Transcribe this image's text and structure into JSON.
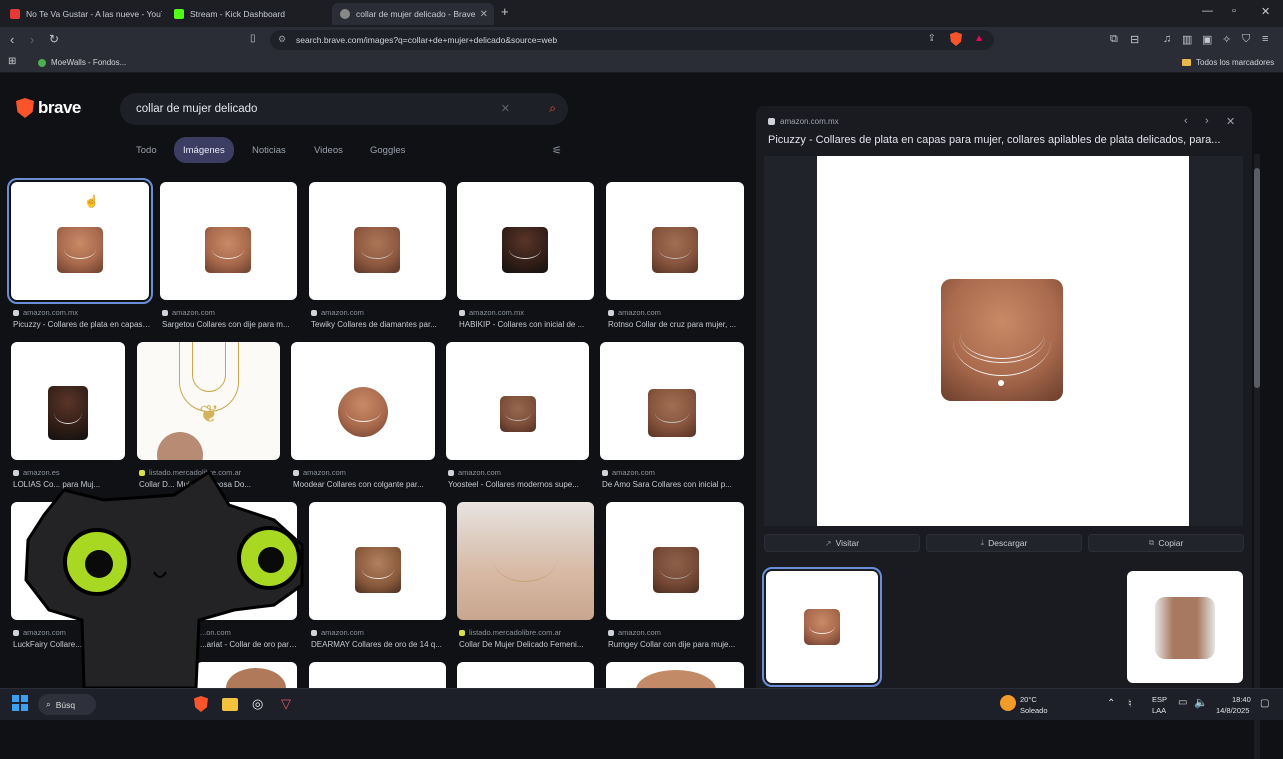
{
  "browser": {
    "tabs": [
      {
        "title": "No Te Va Gustar - A las nueve - YouTube",
        "active": false
      },
      {
        "title": "Stream - Kick Dashboard",
        "active": false
      },
      {
        "title": "collar de mujer delicado - Brave",
        "active": true
      }
    ],
    "new_tab": "+",
    "url": "search.brave.com/images?q=collar+de+mujer+delicado&source=web",
    "bookmarks": {
      "left": "MoeWalls - Fondos...",
      "right": "Todos los marcadores"
    }
  },
  "search": {
    "logo_text": "brave",
    "query": "collar de mujer delicado",
    "tabs": [
      "Todo",
      "Imágenes",
      "Noticias",
      "Videos",
      "Goggles"
    ],
    "active_tab": "Imágenes"
  },
  "results": [
    {
      "source": "amazon.com.mx",
      "title": "Picuzzy - Collares de plata en capas para mujer..."
    },
    {
      "source": "amazon.com",
      "title": "Sargetou Collares con dije para m..."
    },
    {
      "source": "amazon.com",
      "title": "Tewiky Collares de diamantes par..."
    },
    {
      "source": "amazon.com.mx",
      "title": "HABIKIP - Collares con inicial de ..."
    },
    {
      "source": "amazon.com",
      "title": "Rotnso Collar de cruz para mujer, ..."
    },
    {
      "source": "amazon.es",
      "title": "LOLIAS Co... para Muj..."
    },
    {
      "source": "listado.mercadolibre.com.ar",
      "title": "Collar D... Mujer Mariposa Do..."
    },
    {
      "source": "amazon.com",
      "title": "Moodear Collares con colgante par..."
    },
    {
      "source": "amazon.com",
      "title": "Yoosteel - Collares modernos supe..."
    },
    {
      "source": "amazon.com",
      "title": "De Amo Sara Collares con inicial p..."
    },
    {
      "source": "amazon.com",
      "title": "LuckFairy Collare..."
    },
    {
      "source": "...on.com",
      "title": "...ariat - Collar de oro para ..."
    },
    {
      "source": "amazon.com",
      "title": "DEARMAY Collares de oro de 14 q..."
    },
    {
      "source": "listado.mercadolibre.com.ar",
      "title": "Collar De Mujer Delicado Femeni..."
    },
    {
      "source": "amazon.com",
      "title": "Rumgey Collar con dije para muje..."
    }
  ],
  "panel": {
    "source": "amazon.com.mx",
    "title": "Picuzzy - Collares de plata en capas para mujer, collares apilables de plata delicados, para...",
    "buttons": {
      "visit": "Visitar",
      "download": "Descargar",
      "copy": "Copiar"
    }
  },
  "taskbar": {
    "search": "Búsq",
    "weather_temp": "20°C",
    "weather_desc": "Soleado",
    "lang": "ESP",
    "lang2": "LAA",
    "time": "18:40",
    "date": "14/8/2025"
  },
  "colors": {
    "brand": "#fb542b",
    "active_tab": "#3b3e62",
    "selection": "#6a8fd8"
  }
}
